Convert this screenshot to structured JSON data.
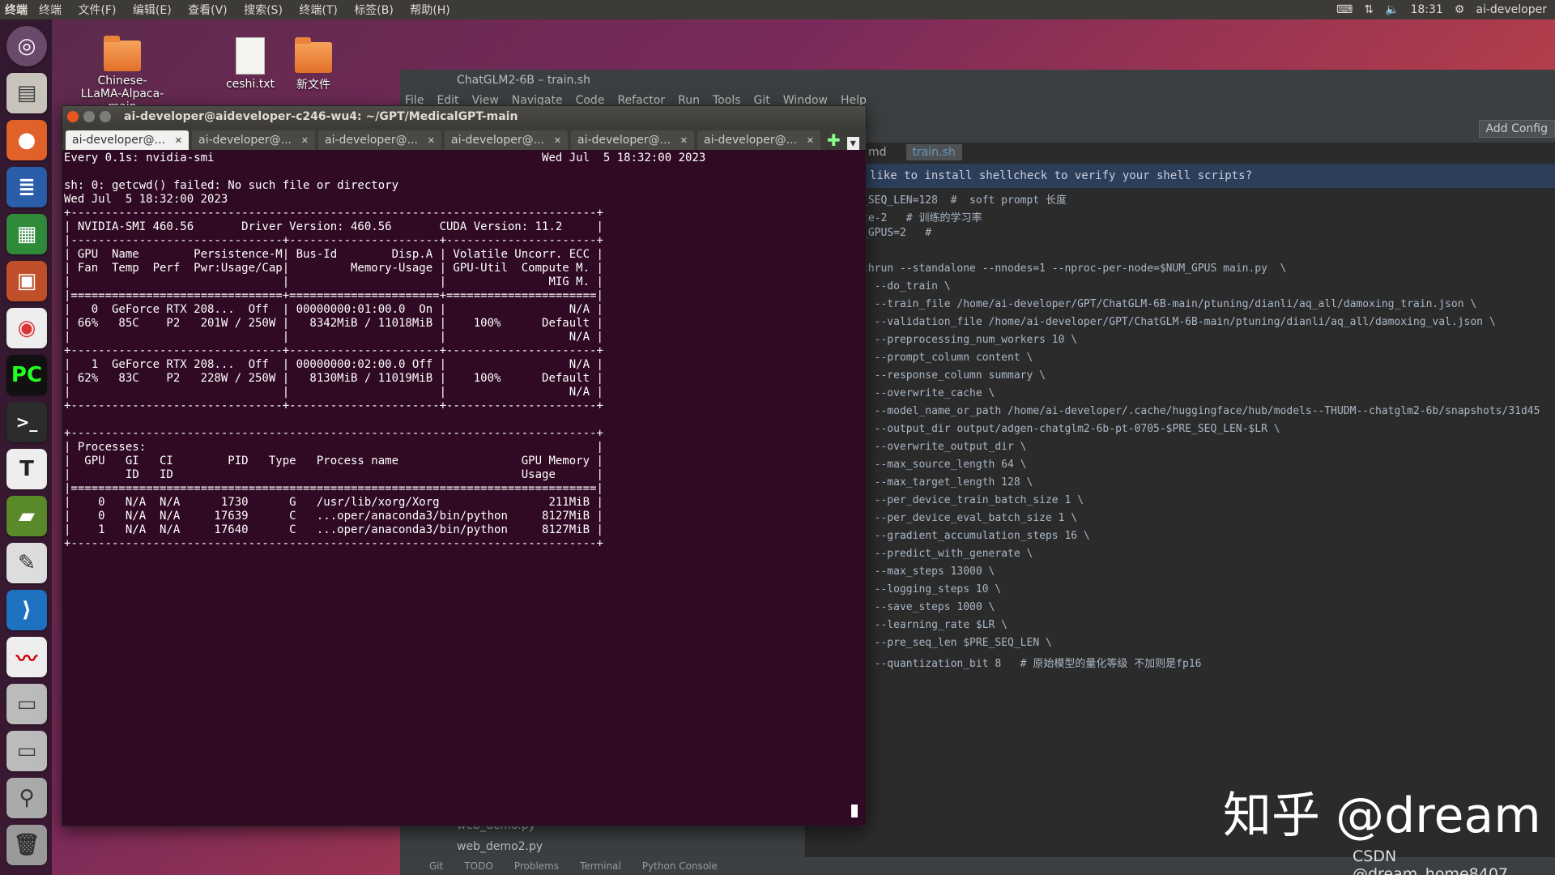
{
  "topbar": {
    "app_name": "终端",
    "menus": [
      "终端",
      "文件(F)",
      "编辑(E)",
      "查看(V)",
      "搜索(S)",
      "终端(T)",
      "标签(B)",
      "帮助(H)"
    ],
    "time": "18:31",
    "user": "ai-developer"
  },
  "desktop": {
    "items": [
      {
        "label": "Chinese-LLaMA-Alpaca-main"
      },
      {
        "label": "ceshi.txt"
      },
      {
        "label": "新文件"
      }
    ]
  },
  "ide": {
    "title": "ChatGLM2-6B – train.sh",
    "menus": [
      "File",
      "Edit",
      "View",
      "Navigate",
      "Code",
      "Refactor",
      "Run",
      "Tools",
      "Git",
      "Window",
      "Help"
    ],
    "add_config": "Add Config",
    "tabs": [
      "md",
      "train.sh"
    ],
    "banner": "like to install shellcheck to verify your shell scripts?",
    "files": [
      "web_demo.py",
      "web_demo2.py"
    ],
    "status_items": [
      "Git",
      "TODO",
      "Problems",
      "Terminal",
      "Python Console"
    ],
    "code_lines": [
      "_SEQ_LEN=128  #  soft prompt 长度",
      "2e-2   # 训练的学习率",
      "_GPUS=2   #",
      "",
      "chrun --standalone --nnodes=1 --nproc-per-node=$NUM_GPUS main.py  \\",
      "  --do_train \\",
      "  --train_file /home/ai-developer/GPT/ChatGLM-6B-main/ptuning/dianli/aq_all/damoxing_train.json \\",
      "  --validation_file /home/ai-developer/GPT/ChatGLM-6B-main/ptuning/dianli/aq_all/damoxing_val.json \\",
      "  --preprocessing_num_workers 10 \\",
      "  --prompt_column content \\",
      "  --response_column summary \\",
      "  --overwrite_cache \\",
      "  --model_name_or_path /home/ai-developer/.cache/huggingface/hub/models--THUDM--chatglm2-6b/snapshots/31d45",
      "  --output_dir output/adgen-chatglm2-6b-pt-0705-$PRE_SEQ_LEN-$LR \\",
      "  --overwrite_output_dir \\",
      "  --max_source_length 64 \\",
      "  --max_target_length 128 \\",
      "  --per_device_train_batch_size 1 \\",
      "  --per_device_eval_batch_size 1 \\",
      "  --gradient_accumulation_steps 16 \\",
      "  --predict_with_generate \\",
      "  --max_steps 13000 \\",
      "  --logging_steps 10 \\",
      "  --save_steps 1000 \\",
      "  --learning_rate $LR \\",
      "  --pre_seq_len $PRE_SEQ_LEN \\",
      "  --quantization_bit 8   # 原始模型的量化等级 不加则是fp16"
    ]
  },
  "terminal": {
    "title": "ai-developer@aideveloper-c246-wu4: ~/GPT/MedicalGPT-main",
    "tabs": [
      "ai-developer@...",
      "ai-developer@...",
      "ai-developer@...",
      "ai-developer@...",
      "ai-developer@...",
      "ai-developer@..."
    ],
    "lines": [
      "Every 0.1s: nvidia-smi                                                Wed Jul  5 18:32:00 2023",
      "",
      "sh: 0: getcwd() failed: No such file or directory",
      "Wed Jul  5 18:32:00 2023",
      "+-----------------------------------------------------------------------------+",
      "| NVIDIA-SMI 460.56       Driver Version: 460.56       CUDA Version: 11.2     |",
      "|-------------------------------+----------------------+----------------------+",
      "| GPU  Name        Persistence-M| Bus-Id        Disp.A | Volatile Uncorr. ECC |",
      "| Fan  Temp  Perf  Pwr:Usage/Cap|         Memory-Usage | GPU-Util  Compute M. |",
      "|                               |                      |               MIG M. |",
      "|===============================+======================+======================|",
      "|   0  GeForce RTX 208...  Off  | 00000000:01:00.0  On |                  N/A |",
      "| 66%   85C    P2   201W / 250W |   8342MiB / 11018MiB |    100%      Default |",
      "|                               |                      |                  N/A |",
      "+-------------------------------+----------------------+----------------------+",
      "|   1  GeForce RTX 208...  Off  | 00000000:02:00.0 Off |                  N/A |",
      "| 62%   83C    P2   228W / 250W |   8130MiB / 11019MiB |    100%      Default |",
      "|                               |                      |                  N/A |",
      "+-------------------------------+----------------------+----------------------+",
      "",
      "+-----------------------------------------------------------------------------+",
      "| Processes:                                                                  |",
      "|  GPU   GI   CI        PID   Type   Process name                  GPU Memory |",
      "|        ID   ID                                                   Usage      |",
      "|=============================================================================|",
      "|    0   N/A  N/A      1730      G   /usr/lib/xorg/Xorg                211MiB |",
      "|    0   N/A  N/A     17639      C   ...oper/anaconda3/bin/python     8127MiB |",
      "|    1   N/A  N/A     17640      C   ...oper/anaconda3/bin/python     8127MiB |",
      "+-----------------------------------------------------------------------------+"
    ]
  },
  "watermark": {
    "main": "知乎 @dream",
    "csdn": "CSDN @dream_home8407"
  },
  "colors": {
    "terminal_bg": "#300a24",
    "ide_bg": "#2b2b2b",
    "topbar_bg": "#3c3b37"
  }
}
